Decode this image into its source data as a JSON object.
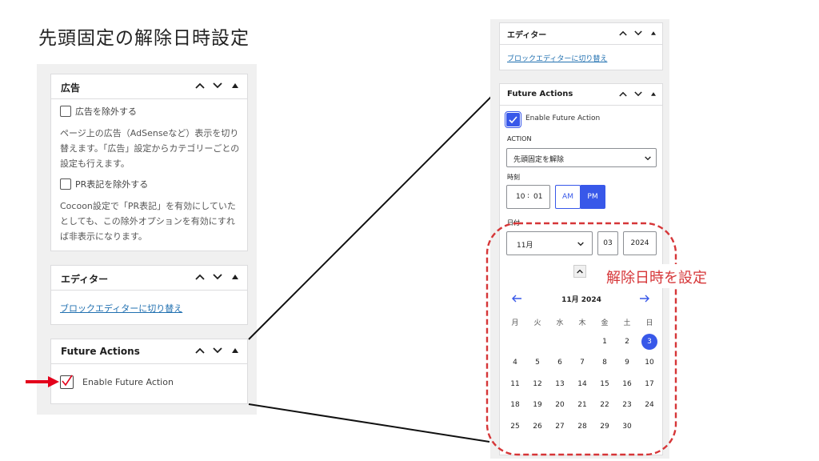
{
  "page_title": "先頭固定の解除日時設定",
  "left": {
    "ad_panel": {
      "title": "広告",
      "exclude_ads_label": "広告を除外する",
      "ads_desc": "ページ上の広告（AdSenseなど）表示を切り替えます。「広告」設定からカテゴリーごとの設定も行えます。",
      "exclude_pr_label": "PR表記を除外する",
      "pr_desc": "Cocoon設定で「PR表記」を有効にしていたとしても、この除外オプションを有効にすれば非表示になります。"
    },
    "editor_panel": {
      "title": "エディター",
      "switch_link": "ブロックエディターに切り替え"
    },
    "future_panel": {
      "title": "Future Actions",
      "enable_label": "Enable Future Action",
      "enable_checked": true
    }
  },
  "right": {
    "editor_panel": {
      "title": "エディター",
      "switch_link": "ブロックエディターに切り替え"
    },
    "future_panel": {
      "title": "Future Actions",
      "enable_label": "Enable Future Action",
      "enable_checked": true,
      "action_label": "ACTION",
      "action_value": "先頭固定を解除",
      "time_label": "時刻",
      "hour": "10",
      "minute": "01",
      "am": "AM",
      "pm": "PM",
      "date_label": "日付",
      "month_value": "11月",
      "day_value": "03",
      "year_value": "2024",
      "calendar": {
        "title": "11月 2024",
        "weekdays": [
          "月",
          "火",
          "水",
          "木",
          "金",
          "土",
          "日"
        ],
        "selected_day": "3",
        "rows": [
          [
            "",
            "",
            "",
            "",
            "1",
            "2",
            "3"
          ],
          [
            "4",
            "5",
            "6",
            "7",
            "8",
            "9",
            "10"
          ],
          [
            "11",
            "12",
            "13",
            "14",
            "15",
            "16",
            "17"
          ],
          [
            "18",
            "19",
            "20",
            "21",
            "22",
            "23",
            "24"
          ],
          [
            "25",
            "26",
            "27",
            "28",
            "29",
            "30",
            ""
          ]
        ]
      }
    }
  },
  "annotation": {
    "callout": "解除日時を設定"
  },
  "colors": {
    "accent": "#3858e9",
    "link": "#2271b1",
    "callout_red": "#d63638",
    "arrow_red": "#e3001b"
  }
}
